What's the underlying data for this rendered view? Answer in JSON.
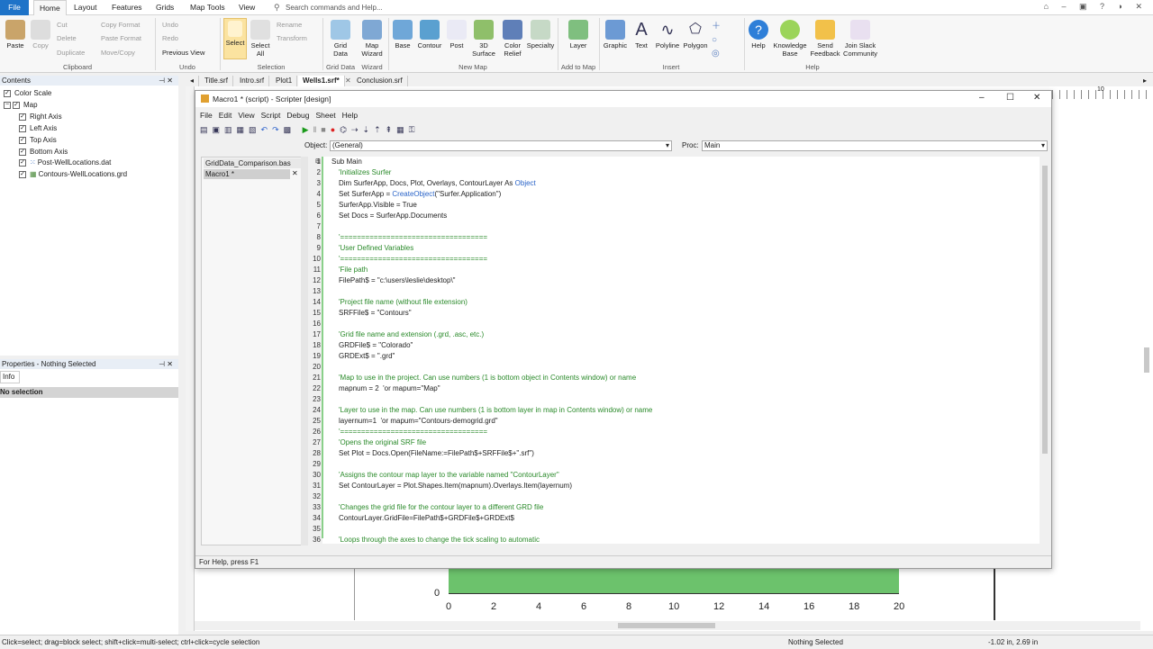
{
  "menu": {
    "tabs": [
      "File",
      "Home",
      "Layout",
      "Features",
      "Grids",
      "Map Tools",
      "View"
    ],
    "search_placeholder": "Search commands and Help..."
  },
  "ribbon": {
    "clipboard": {
      "paste": "Paste",
      "copy": "Copy",
      "cut": "Cut",
      "delete": "Delete",
      "duplicate": "Duplicate",
      "copy_format": "Copy Format",
      "paste_format": "Paste Format",
      "move_copy": "Move/Copy",
      "group": "Clipboard"
    },
    "undo": {
      "undo": "Undo",
      "redo": "Redo",
      "previous_view": "Previous View",
      "group": "Undo"
    },
    "selection": {
      "select": "Select",
      "select_all": "Select All",
      "rename": "Rename",
      "transform": "Transform",
      "group": "Selection"
    },
    "grid_data": {
      "grid_data": "Grid Data",
      "map_wizard": "Map Wizard",
      "g1": "Grid Data",
      "g2": "Wizard"
    },
    "new_map": {
      "items": [
        "Base",
        "Contour",
        "Post",
        "3D Surface",
        "Color Relief",
        "Specialty"
      ],
      "group": "New Map"
    },
    "add_to_map": {
      "layer": "Layer",
      "group": "Add to Map"
    },
    "insert": {
      "items": [
        "Graphic",
        "Text",
        "Polyline",
        "Polygon"
      ],
      "group": "Insert"
    },
    "help": {
      "items": [
        "Help",
        "Knowledge Base",
        "Send Feedback",
        "Join Slack Community"
      ],
      "group": "Help"
    }
  },
  "contents": {
    "title": "Contents",
    "items": [
      "Color Scale",
      "Map",
      "Right Axis",
      "Left Axis",
      "Top Axis",
      "Bottom Axis",
      "Post-WellLocations.dat",
      "Contours-WellLocations.grd"
    ]
  },
  "properties": {
    "title": "Properties - Nothing Selected",
    "tab": "Info",
    "empty": "No selection"
  },
  "doc_tabs": [
    "Title.srf",
    "Intro.srf",
    "Plot1",
    "Wells1.srf*",
    "Conclusion.srf"
  ],
  "scripter": {
    "title": "Macro1 * (script) - Scripter [design]",
    "menu": [
      "File",
      "Edit",
      "View",
      "Script",
      "Debug",
      "Sheet",
      "Help"
    ],
    "object_label": "Object:",
    "object_value": "(General)",
    "proc_label": "Proc:",
    "proc_value": "Main",
    "modules": [
      "GridData_Comparison.bas",
      "Macro1 *"
    ],
    "status": "For Help, press F1"
  },
  "code_lines": [
    "Sub Main",
    "'Initializes Surfer",
    "Dim SurferApp, Docs, Plot, Overlays, ContourLayer As Object",
    "Set SurferApp = CreateObject(\"Surfer.Application\")",
    "SurferApp.Visible = True",
    "Set Docs = SurferApp.Documents",
    "",
    "'===================================",
    "'User Defined Variables",
    "'===================================",
    "'File path",
    "FilePath$ = \"c:\\users\\leslie\\desktop\\\"",
    "",
    "'Project file name (without file extension)",
    "SRFFile$ = \"Contours\"",
    "",
    "'Grid file name and extension (.grd, .asc, etc.)",
    "GRDFile$ = \"Colorado\"",
    "GRDExt$ = \".grd\"",
    "",
    "'Map to use in the project. Can use numbers (1 is bottom object in Contents window) or name",
    "mapnum = 2  'or mapum=\"Map\"",
    "",
    "'Layer to use in the map. Can use numbers (1 is bottom layer in map in Contents window) or name",
    "layernum=1  'or mapum=\"Contours-demogrid.grd\"",
    "'===================================",
    "'Opens the original SRF file",
    "Set Plot = Docs.Open(FileName:=FilePath$+SRFFile$+\".srf\")",
    "",
    "'Assigns the contour map layer to the variable named \"ContourLayer\"",
    "Set ContourLayer = Plot.Shapes.Item(mapnum).Overlays.Item(layernum)",
    "",
    "'Changes the grid file for the contour layer to a different GRD file",
    "ContourLayer.GridFile=FilePath$+GRDFile$+GRDExt$",
    "",
    "'Loops through the axes to change the tick scaling to automatic"
  ],
  "chart_axis": {
    "zero": "0",
    "ticks": [
      "0",
      "2",
      "4",
      "6",
      "8",
      "10",
      "12",
      "14",
      "16",
      "18",
      "20"
    ],
    "ruler_top": "10"
  },
  "statusbar": {
    "left": "Click=select; drag=block select; shift+click=multi-select; ctrl+click=cycle selection",
    "middle": "Nothing Selected",
    "right": "-1.02 in, 2.69 in"
  },
  "colors": {
    "accent": "#1e73c8",
    "plot_fill": "#6cc26c",
    "comment": "#2a8a2a",
    "keyword": "#2a64c8"
  }
}
